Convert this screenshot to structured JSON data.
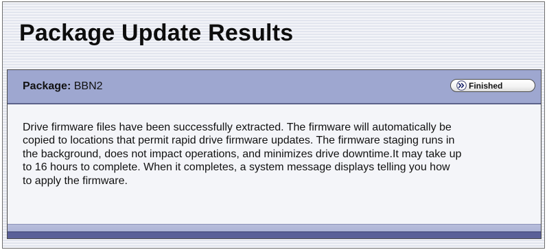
{
  "page": {
    "title": "Package Update Results"
  },
  "package": {
    "label": "Package:",
    "name": "BBN2"
  },
  "status": {
    "label": "Finished",
    "icon": "double-chevron-right-icon"
  },
  "message": {
    "text": "Drive firmware files have been successfully extracted. The firmware will automatically be copied to locations that permit rapid drive firmware updates. The firmware staging runs in the background, does not impact operations, and minimizes drive downtime.It may take up to 16 hours to complete. When it completes, a system message displays telling you how to apply the firmware."
  },
  "colors": {
    "header_bar": "#9ea7d0",
    "footer_bar": "#5a6098",
    "background_stripes": "#e2e5ee"
  }
}
